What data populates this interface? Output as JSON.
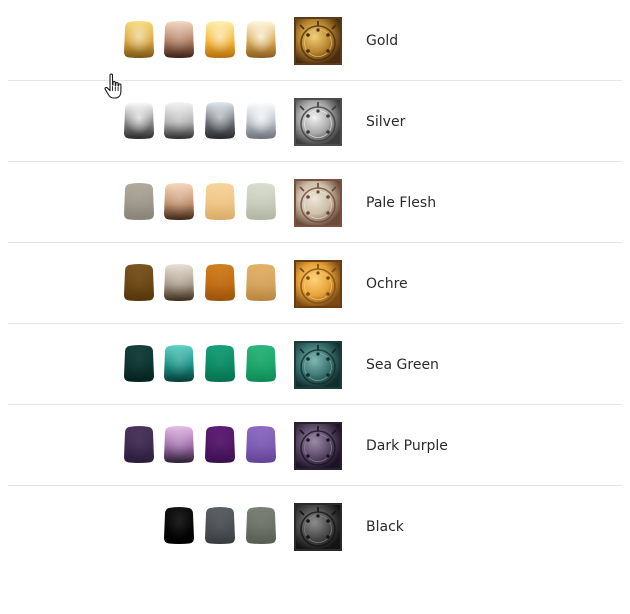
{
  "colors": [
    {
      "name": "Gold",
      "swatches": [
        {
          "light": "#f7da7c",
          "base": "#d8a53e",
          "dark": "#7a5418",
          "shine": 0.55
        },
        {
          "light": "#f3d9c3",
          "base": "#b07d62",
          "dark": "#3a1f14",
          "shine": 0.2
        },
        {
          "light": "#fff0a8",
          "base": "#f4b536",
          "dark": "#b56d0c",
          "shine": 0.6
        },
        {
          "light": "#fff8dc",
          "base": "#d9a954",
          "dark": "#8a5b1e",
          "shine": 0.75
        }
      ],
      "thumb": {
        "light": "#f1d27a",
        "mid": "#b9852f",
        "dark": "#4a2d0c",
        "frame": "#5a3a1a"
      }
    },
    {
      "name": "Silver",
      "swatches": [
        {
          "light": "#ffffff",
          "base": "#8a8a8a",
          "dark": "#2a2a2a",
          "shine": 0.7
        },
        {
          "light": "#f5f5f5",
          "base": "#b0b0b0",
          "dark": "#2b2b2b",
          "shine": 0.3
        },
        {
          "light": "#e0e8f0",
          "base": "#6c7075",
          "dark": "#23272b",
          "shine": 0.5
        },
        {
          "light": "#ffffff",
          "base": "#b9c0c7",
          "dark": "#6a7178",
          "shine": 0.8
        }
      ],
      "thumb": {
        "light": "#f2f2f2",
        "mid": "#a8a8a8",
        "dark": "#3c3c3c",
        "frame": "#4c4c4c"
      }
    },
    {
      "name": "Pale Flesh",
      "swatches": [
        {
          "light": "#b0ab9c",
          "base": "#9d988b",
          "dark": "#878274",
          "shine": 0.05
        },
        {
          "light": "#f6d9bf",
          "base": "#c2906e",
          "dark": "#3e2416",
          "shine": 0.2
        },
        {
          "light": "#f7d49c",
          "base": "#eec585",
          "dark": "#d9ab66",
          "shine": 0.05
        },
        {
          "light": "#d9ddd0",
          "base": "#c8ccbb",
          "dark": "#b0b4a2",
          "shine": 0.05
        }
      ],
      "thumb": {
        "light": "#efe6d8",
        "mid": "#cdbfa9",
        "dark": "#6b4a3a",
        "frame": "#7a5040"
      }
    },
    {
      "name": "Ochre",
      "swatches": [
        {
          "light": "#7a5420",
          "base": "#6a4614",
          "dark": "#54350c",
          "shine": 0.05
        },
        {
          "light": "#e8e0d5",
          "base": "#a79a87",
          "dark": "#3b2b1a",
          "shine": 0.2
        },
        {
          "light": "#d0801c",
          "base": "#c06b12",
          "dark": "#9a520a",
          "shine": 0.05
        },
        {
          "light": "#e3b268",
          "base": "#d5a35a",
          "dark": "#b88440",
          "shine": 0.05
        }
      ],
      "thumb": {
        "light": "#ffd27a",
        "mid": "#e8a33a",
        "dark": "#7a4a12",
        "frame": "#6a3e10"
      }
    },
    {
      "name": "Sea Green",
      "swatches": [
        {
          "light": "#14403c",
          "base": "#0c332f",
          "dark": "#052320",
          "shine": 0.05
        },
        {
          "light": "#5fd1c4",
          "base": "#1a8f84",
          "dark": "#073c36",
          "shine": 0.2
        },
        {
          "light": "#17a078",
          "base": "#0a8a63",
          "dark": "#06704f",
          "shine": 0.05
        },
        {
          "light": "#2cb57a",
          "base": "#1aa56a",
          "dark": "#0f8a55",
          "shine": 0.05
        }
      ],
      "thumb": {
        "light": "#7fb9b4",
        "mid": "#3d7470",
        "dark": "#102e2c",
        "frame": "#1c3c3a"
      }
    },
    {
      "name": "Dark Purple",
      "swatches": [
        {
          "light": "#4a345c",
          "base": "#3d2a4f",
          "dark": "#2c1c3b",
          "shine": 0.05
        },
        {
          "light": "#e4bde6",
          "base": "#9a6aa6",
          "dark": "#2c1c33",
          "shine": 0.2
        },
        {
          "light": "#5c1c74",
          "base": "#501766",
          "dark": "#3d0f50",
          "shine": 0.05
        },
        {
          "light": "#8c6cc0",
          "base": "#7b5ab1",
          "dark": "#634397",
          "shine": 0.05
        }
      ],
      "thumb": {
        "light": "#9a8aa8",
        "mid": "#5b4a68",
        "dark": "#1c1424",
        "frame": "#2a2030"
      }
    },
    {
      "name": "Black",
      "swatches": [
        {
          "light": "#111111",
          "base": "#050505",
          "dark": "#000000",
          "shine": 0.1
        },
        {
          "light": "#5a5e62",
          "base": "#4b4f53",
          "dark": "#3a3d40",
          "shine": 0.05
        },
        {
          "light": "#7a8076",
          "base": "#6a7066",
          "dark": "#585d54",
          "shine": 0.05
        }
      ],
      "thumb": {
        "light": "#8e8e8e",
        "mid": "#4a4a4a",
        "dark": "#141414",
        "frame": "#2a2a2a"
      }
    }
  ]
}
